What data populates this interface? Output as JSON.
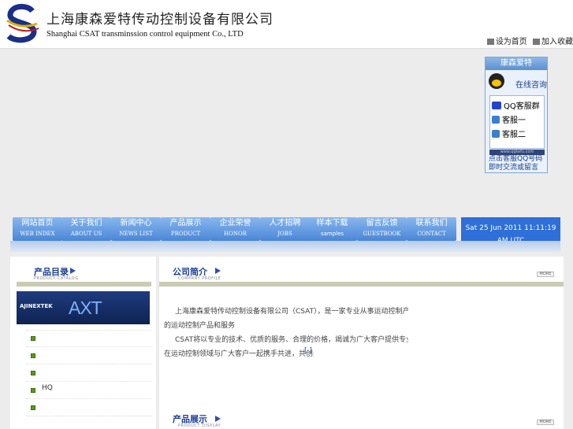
{
  "header": {
    "company_cn": "上海康森爱特传动控制设备有限公司",
    "company_en": "Shanghai CSAT transminssion control equipment Co., LTD",
    "links": [
      "设为首页",
      "加入收藏"
    ]
  },
  "qq_widget": {
    "title": "康森爱特",
    "online": "在线咨询",
    "contacts": [
      "QQ客服群",
      "客服一",
      "客服二"
    ],
    "ad_text": "www.qqkefu.com",
    "footer": [
      "点击客服QQ号码",
      "即时交流或留言"
    ]
  },
  "nav": {
    "items": [
      {
        "cn": "网站首页",
        "en": "WEB INDEX"
      },
      {
        "cn": "关于我们",
        "en": "ABOUT US"
      },
      {
        "cn": "新闻中心",
        "en": "NEWS LIST"
      },
      {
        "cn": "产品展示",
        "en": "PRODUCT"
      },
      {
        "cn": "企业荣誉",
        "en": "HONOR"
      },
      {
        "cn": "人才招聘",
        "en": "JOBS"
      },
      {
        "cn": "样本下载",
        "en": "samples"
      },
      {
        "cn": "留言反馈",
        "en": "GUESTBOOK"
      },
      {
        "cn": "联系我们",
        "en": "CONTACT"
      }
    ],
    "datetime": "Sat 25 Jun 2011 11:11:19 AM UTC"
  },
  "left": {
    "title": "产品目录",
    "subtitle": "PRODUCT CATALOG",
    "banner_left": "AJINEXTEK",
    "banner_right": "AXT",
    "items": [
      "",
      "",
      "",
      "HQ",
      ""
    ]
  },
  "about": {
    "title": "公司简介",
    "subtitle": "COMPANY PROFILE",
    "more": "MORE",
    "line1": "上海康森爱特传动控制设备有限公司（CSAT），是一家专业从事运动控制产品销售、服务的CSAT运动控制产品销售公司。",
    "line2": "的运动控制产品和服务",
    "line3": "CSAT将以专业的技术、优质的服务、合理的价格，竭诚为广大客户提供专业的运动控制解决方案，并已获得广大客户的一致好评，",
    "line4": "在运动控制领域与广大客户一起携手共进，共创美好未来，欢迎来电洽谈合作…",
    "read_more": "[ ]"
  },
  "products": {
    "title": "产品展示",
    "subtitle": "PRODUCT DISPLAY",
    "more": "MORE"
  }
}
